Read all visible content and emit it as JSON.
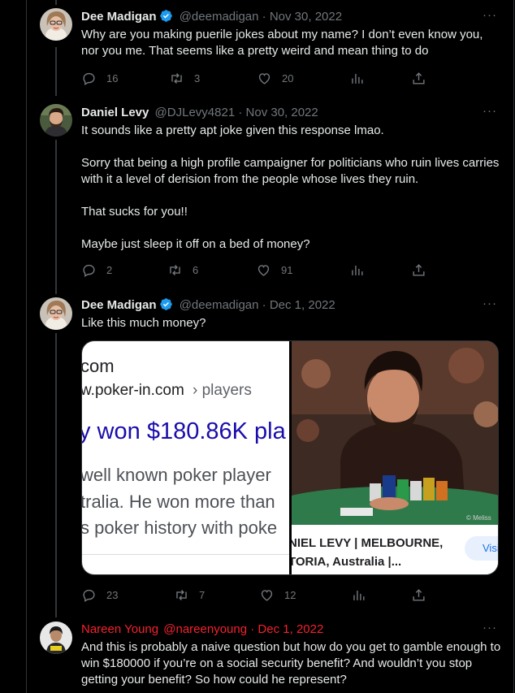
{
  "tweets": [
    {
      "name": "Dee Madigan",
      "handle": "@deemadigan",
      "date": "Nov 30, 2022",
      "text": "Why are you making puerile jokes about my name? I don’t even know you, nor you me. That seems like a pretty weird and mean thing to do",
      "replies": "16",
      "retweets": "3",
      "likes": "20"
    },
    {
      "name": "Daniel Levy",
      "handle": "@DJLevy4821",
      "date": "Nov 30, 2022",
      "paragraphs": [
        "It sounds like a pretty apt joke given this response lmao.",
        "Sorry that being a high profile campaigner for politicians who ruin lives carries with it a level of derision from the people whose lives they ruin.",
        "That sucks for you!!",
        "Maybe just sleep it off on a bed of money?"
      ],
      "replies": "2",
      "retweets": "6",
      "likes": "91"
    },
    {
      "name": "Dee Madigan",
      "handle": "@deemadigan",
      "date": "Dec 1, 2022",
      "text": "Like this much money?",
      "replies": "23",
      "retweets": "7",
      "likes": "12",
      "media": {
        "left_lines": [
          "com",
          "w.poker-in.com",
          "› players",
          "y won $180.86K pla",
          "well known poker player",
          "tralia. He won more than",
          "s poker history with poke"
        ],
        "right_caption_line1": "NIEL LEVY | MELBOURNE,",
        "right_caption_line2": "TORIA, Australia |...",
        "visit_label": "Visi",
        "watermark": "© Meliss"
      }
    },
    {
      "name": "Nareen Young",
      "handle": "@nareenyoung",
      "date": "Dec 1, 2022",
      "text": "And this is probably a naive question but how do you get to gamble enough to win $180000 if you’re on a social security benefit? And wouldn’t you stop getting your benefit? So how could he represent?"
    }
  ],
  "separator": "·",
  "more_label": "···",
  "colors": {
    "background": "#000000",
    "text": "#e7e9ea",
    "muted": "#71767b",
    "verified": "#1d9bf0",
    "highlight_red": "#f4212e"
  },
  "icons": [
    "reply-icon",
    "retweet-icon",
    "like-icon",
    "views-icon",
    "share-icon",
    "verified-badge-icon",
    "more-icon"
  ]
}
